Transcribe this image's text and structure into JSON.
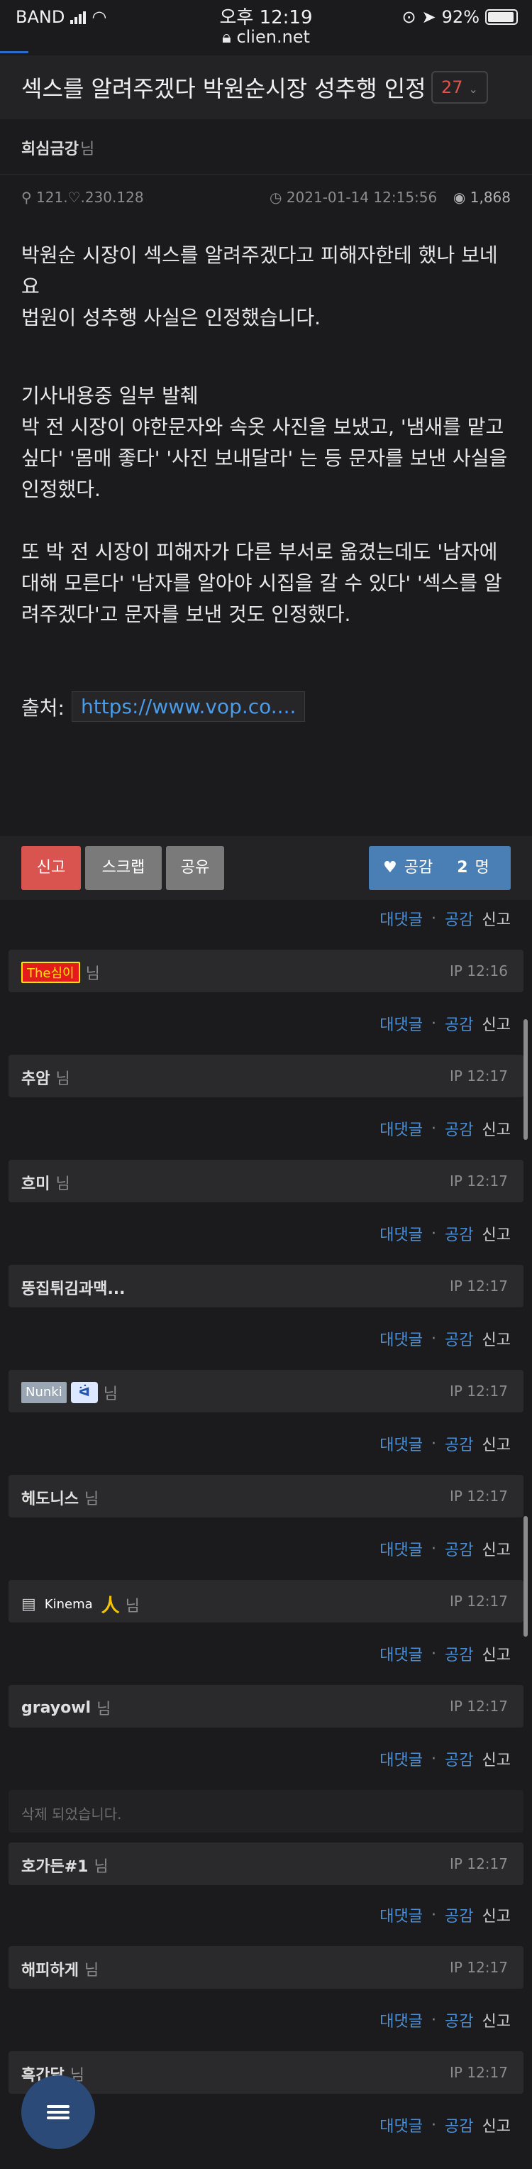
{
  "status": {
    "carrier": "BAND",
    "time": "오후 12:19",
    "url": "clien.net",
    "battery": "92%"
  },
  "post": {
    "title": "섹스를 알려주겠다 박원순시장 성추행 인정",
    "comment_count": "27",
    "author": "희심금강",
    "nim": "님",
    "ip": "121.♡.230.128",
    "date": "2021-01-14 12:15:56",
    "views": "1,868",
    "body": [
      "박원순 시장이 섹스를 알려주겠다고 피해자한테 했나 보네요",
      "법원이 성추행 사실은 인정했습니다.",
      "",
      "기사내용중 일부 발췌",
      "박 전 시장이 야한문자와 속옷 사진을 보냈고, '냄새를 맡고 싶다' '몸매 좋다' '사진 보내달라' 는 등 문자를 보낸 사실을 인정했다.",
      "",
      "또 박 전 시장이 피해자가 다른 부서로 옮겼는데도 '남자에 대해 모른다' '남자를 알아야 시집을 갈 수 있다' '섹스를 알려주겠다'고 문자를 보낸 것도 인정했다."
    ],
    "source_label": "출처:",
    "source_link": "https://www.vop.co...."
  },
  "actions": {
    "report": "신고",
    "scrap": "스크랩",
    "share": "공유",
    "like": "공감",
    "like_count": "2",
    "like_unit": "명"
  },
  "comment_action_labels": {
    "reply": "대댓글",
    "like": "공감",
    "report": "신고"
  },
  "comments": [
    {
      "name": "The심이",
      "ip": "IP",
      "time": "12:16"
    },
    {
      "name": "추암",
      "ip": "IP",
      "time": "12:17"
    },
    {
      "name": "흐미",
      "ip": "IP",
      "time": "12:17"
    },
    {
      "name": "뚱집튀김과맥...",
      "ip": "IP",
      "time": "12:17"
    },
    {
      "name": "Nunki",
      "ip": "IP",
      "time": "12:17"
    },
    {
      "name": "헤도니스",
      "ip": "IP",
      "time": "12:17"
    },
    {
      "name": "Kinema",
      "ip": "IP",
      "time": "12:17"
    },
    {
      "name": "grayowl",
      "ip": "IP",
      "time": "12:17"
    },
    {
      "deleted_text": "삭제 되었습니다."
    },
    {
      "name": "호가든#1",
      "ip": "IP",
      "time": "12:17"
    },
    {
      "name": "해피하게",
      "ip": "IP",
      "time": "12:17"
    },
    {
      "name": "흑간달",
      "ip": "IP",
      "time": "12:17"
    }
  ],
  "colors": {
    "background": "#1b1b1d",
    "accent_red": "#d9534f",
    "link_blue": "#4a8fd6",
    "like_blue": "#4a7fb5"
  }
}
